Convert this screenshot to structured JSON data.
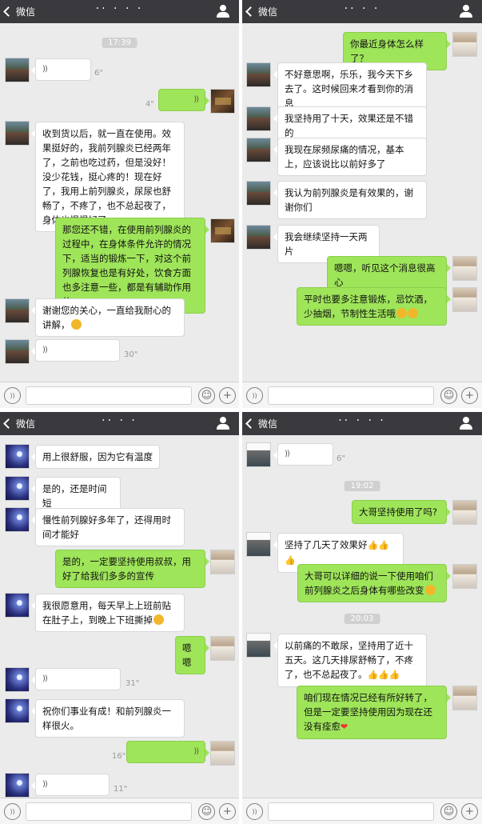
{
  "common": {
    "back_label": "微信",
    "voice_glyph": "))",
    "plus_glyph": "+",
    "emoji_glyph": "☺",
    "voice_btn_glyph": "))"
  },
  "panels": [
    {
      "title": "··  ·  ·  ·",
      "time1": "17:39",
      "m1_dur": "6\"",
      "m2_dur": "4\"",
      "m3": "收到货以后，就一直在使用。效果挺好的，我前列腺炎已经两年了，之前也吃过药，但是没好！没少花钱，挺心疼的！现在好了，我用上前列腺炎，尿尿也舒畅了，不疼了，也不总起夜了，身体也慢慢好了",
      "m4": "那您还不错，在使用前列腺炎的过程中，在身体条件允许的情况下，适当的锻炼一下，对这个前列腺恢复也是有好处，饮食方面也多注意一些，都是有辅助作用的。",
      "m5": "谢谢您的关心，一直给我耐心的讲解，",
      "m6_dur": "30\""
    },
    {
      "title": "··  ·  ·",
      "m1": "你最近身体怎么样了？",
      "m2": "不好意思啊，乐乐，我今天下乡去了。这时候回来才看到你的消息",
      "m3": "我坚持用了十天，效果还是不错的",
      "m4": "我现在尿频尿痛的情况，基本上，应该说比以前好多了",
      "m5": "我认为前列腺炎是有效果的，谢谢你们",
      "m6": "我会继续坚持一天两片",
      "m7": "嗯嗯，听见这个消息很高心",
      "m8": "平时也要多注意锻炼，忌饮酒，少抽烟，节制性生活哦"
    },
    {
      "title": "··  ·  ·",
      "m1": "用上很舒服，因为它有温度",
      "m2": "是的，还是时间短",
      "m3": "慢性前列腺好多年了，还得用时间才能好",
      "m4": "是的，一定要坚持使用叔叔，用好了给我们多多的宣传",
      "m5": "我很愿意用，每天早上上班前贴在肚子上，到晚上下班撕掉",
      "m6": "嗯嗯",
      "m7_dur": "31\"",
      "m8": "祝你们事业有成！和前列腺炎一样很火。",
      "m9_dur": "16\"",
      "m10_dur": "11\""
    },
    {
      "title": "··  ·  ·  ·",
      "m1_dur": "6\"",
      "time1": "19:02",
      "m2": "大哥坚持使用了吗?",
      "m3": "坚持了几天了效果好",
      "m4": "大哥可以详细的说一下使用咱们前列腺炎之后身体有哪些改变",
      "time2": "20:03",
      "m5": "以前痛的不敢尿，坚持用了近十五天。这几天排尿舒畅了，不疼了，也不总起夜了。",
      "m6": "咱们现在情况已经有所好转了，但是一定要坚持使用因为现在还没有痊愈"
    }
  ]
}
